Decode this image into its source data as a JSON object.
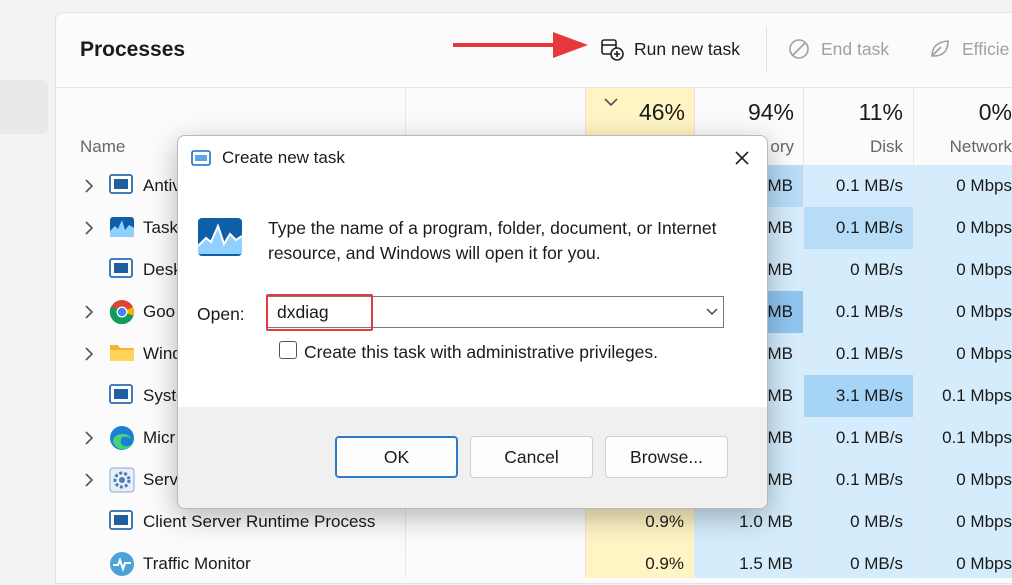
{
  "header": {
    "title": "Processes",
    "run_new_task": "Run new task",
    "end_task": "End task",
    "efficiency": "Efficie"
  },
  "columns": {
    "name_label": "Name",
    "cpu_pct": "46%",
    "memory_pct": "94%",
    "memory_label": "ory",
    "disk_pct": "11%",
    "disk_label": "Disk",
    "network_pct": "0%",
    "network_label": "Network"
  },
  "rows": [
    {
      "name": "Antiv",
      "memory": "MB",
      "disk": "0.1 MB/s",
      "network": "0 Mbps",
      "expand": true,
      "icon": "window-icon"
    },
    {
      "name": "Task",
      "memory": "MB",
      "disk": "0.1 MB/s",
      "network": "0 Mbps",
      "expand": true,
      "icon": "task-manager-icon"
    },
    {
      "name": "Desk",
      "memory": "MB",
      "disk": "0 MB/s",
      "network": "0 Mbps",
      "expand": false,
      "icon": "window-icon"
    },
    {
      "name": "Goo",
      "memory": "MB",
      "disk": "0.1 MB/s",
      "network": "0 Mbps",
      "expand": true,
      "icon": "chrome-icon"
    },
    {
      "name": "Wind",
      "memory": "MB",
      "disk": "0.1 MB/s",
      "network": "0 Mbps",
      "expand": true,
      "icon": "folder-icon"
    },
    {
      "name": "Syste",
      "memory": "MB",
      "disk": "3.1 MB/s",
      "network": "0.1 Mbps",
      "expand": false,
      "icon": "window-icon"
    },
    {
      "name": "Micr",
      "memory": "MB",
      "disk": "0.1 MB/s",
      "network": "0.1 Mbps",
      "expand": true,
      "icon": "edge-icon"
    },
    {
      "name": "Serv",
      "memory": "MB",
      "disk": "0.1 MB/s",
      "network": "0 Mbps",
      "expand": true,
      "icon": "gear-icon"
    },
    {
      "name": "Client Server Runtime Process",
      "cpu": "0.9%",
      "memory": "1.0 MB",
      "disk": "0 MB/s",
      "network": "0 Mbps",
      "expand": false,
      "icon": "window-icon"
    },
    {
      "name": "Traffic Monitor",
      "cpu": "0.9%",
      "memory": "1.5 MB",
      "disk": "0 MB/s",
      "network": "0 Mbps",
      "expand": false,
      "icon": "traffic-monitor-icon"
    }
  ],
  "dialog": {
    "title": "Create new task",
    "description": "Type the name of a program, folder, document, or Internet resource, and Windows will open it for you.",
    "open_label": "Open:",
    "open_value": "dxdiag",
    "admin_checkbox_label": "Create this task with administrative privileges.",
    "admin_checked": false,
    "ok": "OK",
    "cancel": "Cancel",
    "browse": "Browse..."
  },
  "colors": {
    "cpu_fill": "#fff4c4",
    "light_blue": "#d4ecfc",
    "mid_blue": "#b6dcf8",
    "strong_blue": "#8fc5f0",
    "annotation_red": "#e5393b"
  }
}
